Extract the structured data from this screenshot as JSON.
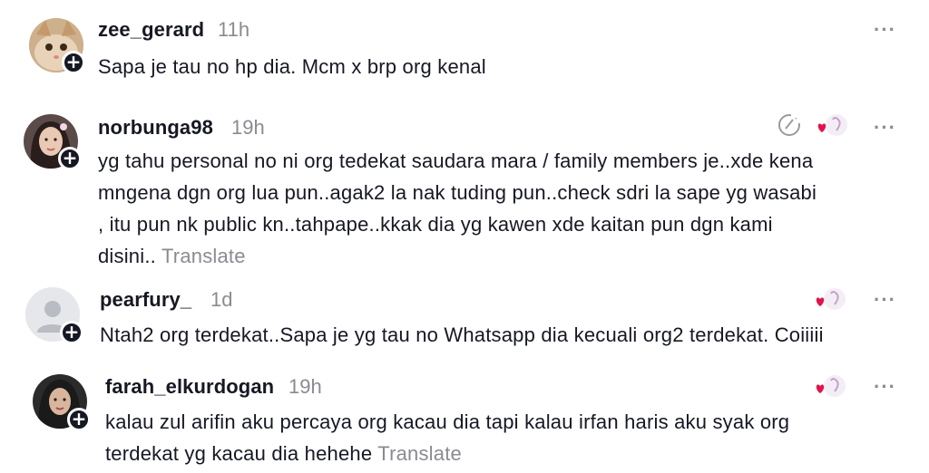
{
  "comments": [
    {
      "username": "zee_gerard",
      "time": "11h",
      "text": "Sapa je tau no hp dia. Mcm x brp org kenal",
      "translate": "",
      "more": "···"
    },
    {
      "username": "norbunga98",
      "time": "19h",
      "lines": [
        "yg tahu personal no ni org tedekat saudara mara / family members je..xde kena",
        "mngena dgn org lua pun..agak2 la nak tuding pun..check sdri la sape yg wasabi",
        ", itu pun nk public kn..tahpape..kkak dia yg kawen xde kaitan pun dgn kami",
        "disini.."
      ],
      "translate": "Translate",
      "more": "···"
    },
    {
      "username": "pearfury_",
      "time": "1d",
      "text": "Ntah2 org terdekat..Sapa je yg tau no Whatsapp dia kecuali org2 terdekat. Coiiiii",
      "more": "···"
    },
    {
      "username": "farah_elkurdogan",
      "time": "19h",
      "lines": [
        "kalau zul arifin aku percaya org kacau dia tapi kalau irfan haris aku syak org",
        "terdekat yg kacau dia hehehe"
      ],
      "translate": "Translate",
      "more": "···"
    }
  ],
  "colors": {
    "text": "#161823",
    "muted": "#8a8b91",
    "like_heart": "#e0144c"
  },
  "icons": {
    "follow": "plus-icon",
    "more": "more-icon",
    "edit": "edit-icon",
    "liked_by_creator": "heart-avatar-icon"
  }
}
